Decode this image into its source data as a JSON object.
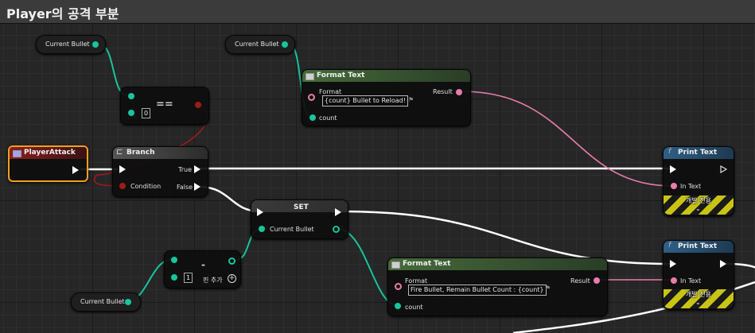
{
  "comment_title": "Player의 공격 부분",
  "nodes": {
    "get_current_bullet_1": {
      "label": "Current Bullet"
    },
    "get_current_bullet_2": {
      "label": "Current Bullet"
    },
    "get_current_bullet_3": {
      "label": "Current Bullet"
    },
    "equal": {
      "op": "==",
      "value": "0"
    },
    "format_text_1": {
      "title": "Format Text",
      "format_label": "Format",
      "format_value": "{count} Bullet to Reload!",
      "result_label": "Result",
      "count_label": "count"
    },
    "event": {
      "title": "PlayerAttack"
    },
    "branch": {
      "title": "Branch",
      "true_label": "True",
      "false_label": "False",
      "condition_label": "Condition"
    },
    "set": {
      "title": "SET",
      "var_label": "Current Bullet"
    },
    "subtract": {
      "op": "-",
      "value": "1",
      "add_pin_label": "핀 추가"
    },
    "print_text_1": {
      "title": "Print Text",
      "in_text_label": "In Text",
      "dev_label": "개발 전용"
    },
    "print_text_2": {
      "title": "Print Text",
      "in_text_label": "In Text",
      "dev_label": "개발 전용"
    },
    "format_text_2": {
      "title": "Format Text",
      "format_label": "Format",
      "format_value": "Fire Bullet, Remain Bullet Count : {count}",
      "result_label": "Result",
      "count_label": "count"
    }
  },
  "colors": {
    "exec_wire": "#ffffff",
    "int_wire": "#18c49b",
    "text_wire": "#e87cab",
    "bool_wire": "#9e1b1b",
    "event_header": "#8a1f1f",
    "func_header": "#2f5f86",
    "format_header": "#456b3a",
    "accent_border": "#f0a020"
  }
}
